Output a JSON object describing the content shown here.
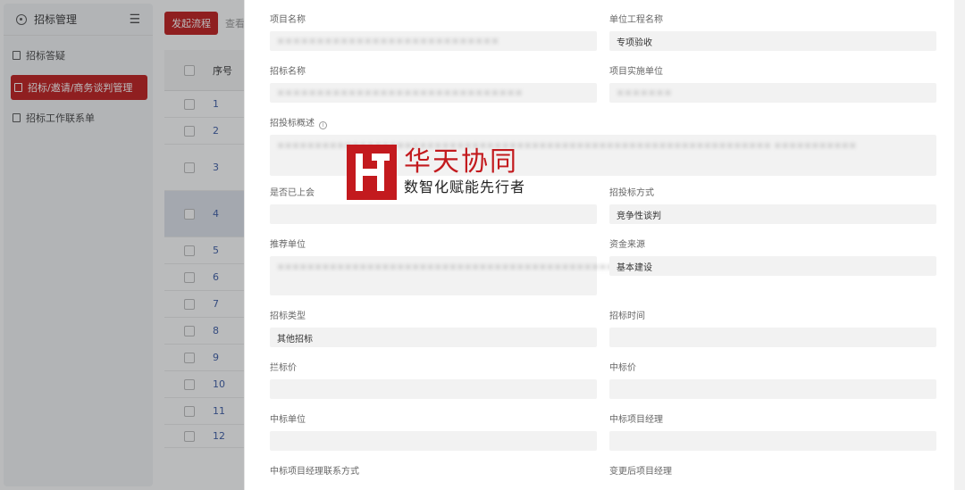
{
  "sidebar": {
    "title": "招标管理",
    "items": [
      {
        "label": "招标答疑"
      },
      {
        "label": "招标/邀请/商务谈判管理"
      },
      {
        "label": "招标工作联系单"
      }
    ]
  },
  "toolbar": {
    "start_label": "发起流程",
    "ghost_label": "查看"
  },
  "table": {
    "header_index": "序号",
    "rows": [
      "1",
      "2",
      "3",
      "4",
      "5",
      "6",
      "7",
      "8",
      "9",
      "10",
      "11",
      "12"
    ]
  },
  "form": {
    "project_name": {
      "label": "项目名称",
      "value": "××××××××××××××××××××××××××××"
    },
    "unit_project_name": {
      "label": "单位工程名称",
      "value": "专项验收"
    },
    "bid_name": {
      "label": "招标名称",
      "value": "×××××××××××××××××××××××××××××××"
    },
    "implementing_unit": {
      "label": "项目实施单位",
      "value": "×××××××"
    },
    "bid_overview": {
      "label": "招投标概述",
      "value": "×××××××××××××××××××××××××××××××××××××××××××××××××××××××××××××××××× ×××××××××××"
    },
    "on_meeting": {
      "label": "是否已上会",
      "value": ""
    },
    "bid_method": {
      "label": "招投标方式",
      "value": "竞争性谈判"
    },
    "recommended_unit": {
      "label": "推荐单位",
      "value": "×××××××××××××××××××××××××××××××××××××××××××××××"
    },
    "fund_source": {
      "label": "资金来源",
      "value": "基本建设"
    },
    "bid_type": {
      "label": "招标类型",
      "value": "其他招标"
    },
    "bid_time": {
      "label": "招标时间",
      "value": ""
    },
    "ceiling_price": {
      "label": "拦标价",
      "value": ""
    },
    "winning_price": {
      "label": "中标价",
      "value": ""
    },
    "winning_unit": {
      "label": "中标单位",
      "value": ""
    },
    "winning_manager": {
      "label": "中标项目经理",
      "value": ""
    },
    "manager_contact": {
      "label": "中标项目经理联系方式"
    },
    "changed_manager": {
      "label": "变更后项目经理"
    }
  },
  "watermark": {
    "brand": "华天协同",
    "slogan": "数智化赋能先行者"
  },
  "colors": {
    "accent": "#c01a1a",
    "field_bg": "#f2f2f2"
  }
}
